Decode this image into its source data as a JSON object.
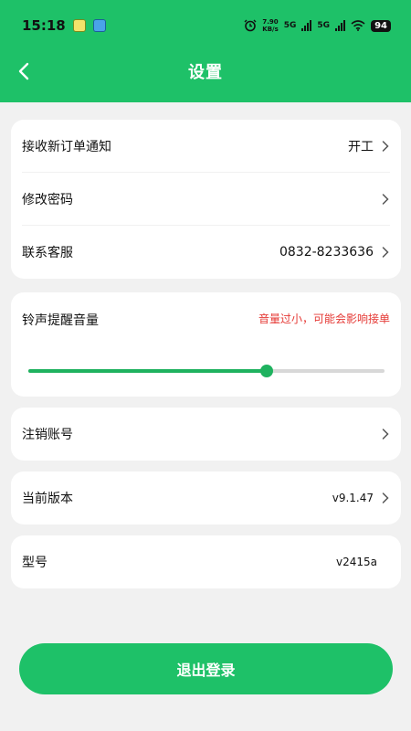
{
  "status_bar": {
    "time": "15:18",
    "net_speed_value": "7.90",
    "net_speed_unit": "KB/s",
    "sim1": "5G",
    "sim2": "5G",
    "battery": "94"
  },
  "header": {
    "title": "设置",
    "back_icon": "chevron-left-icon"
  },
  "settings": {
    "order_notify": {
      "label": "接收新订单通知",
      "value": "开工"
    },
    "change_password": {
      "label": "修改密码"
    },
    "customer_service": {
      "label": "联系客服",
      "value": "0832-8233636"
    }
  },
  "volume": {
    "label": "铃声提醒音量",
    "warning": "音量过小，可能会影响接单",
    "level": 0.67
  },
  "account": {
    "cancel_label": "注销账号"
  },
  "version": {
    "label": "当前版本",
    "value": "v9.1.47"
  },
  "model": {
    "label": "型号",
    "value": "v2415a"
  },
  "logout_label": "退出登录",
  "colors": {
    "brand": "#1ec168",
    "warning": "#e53935",
    "slider": "#1fb25f"
  }
}
